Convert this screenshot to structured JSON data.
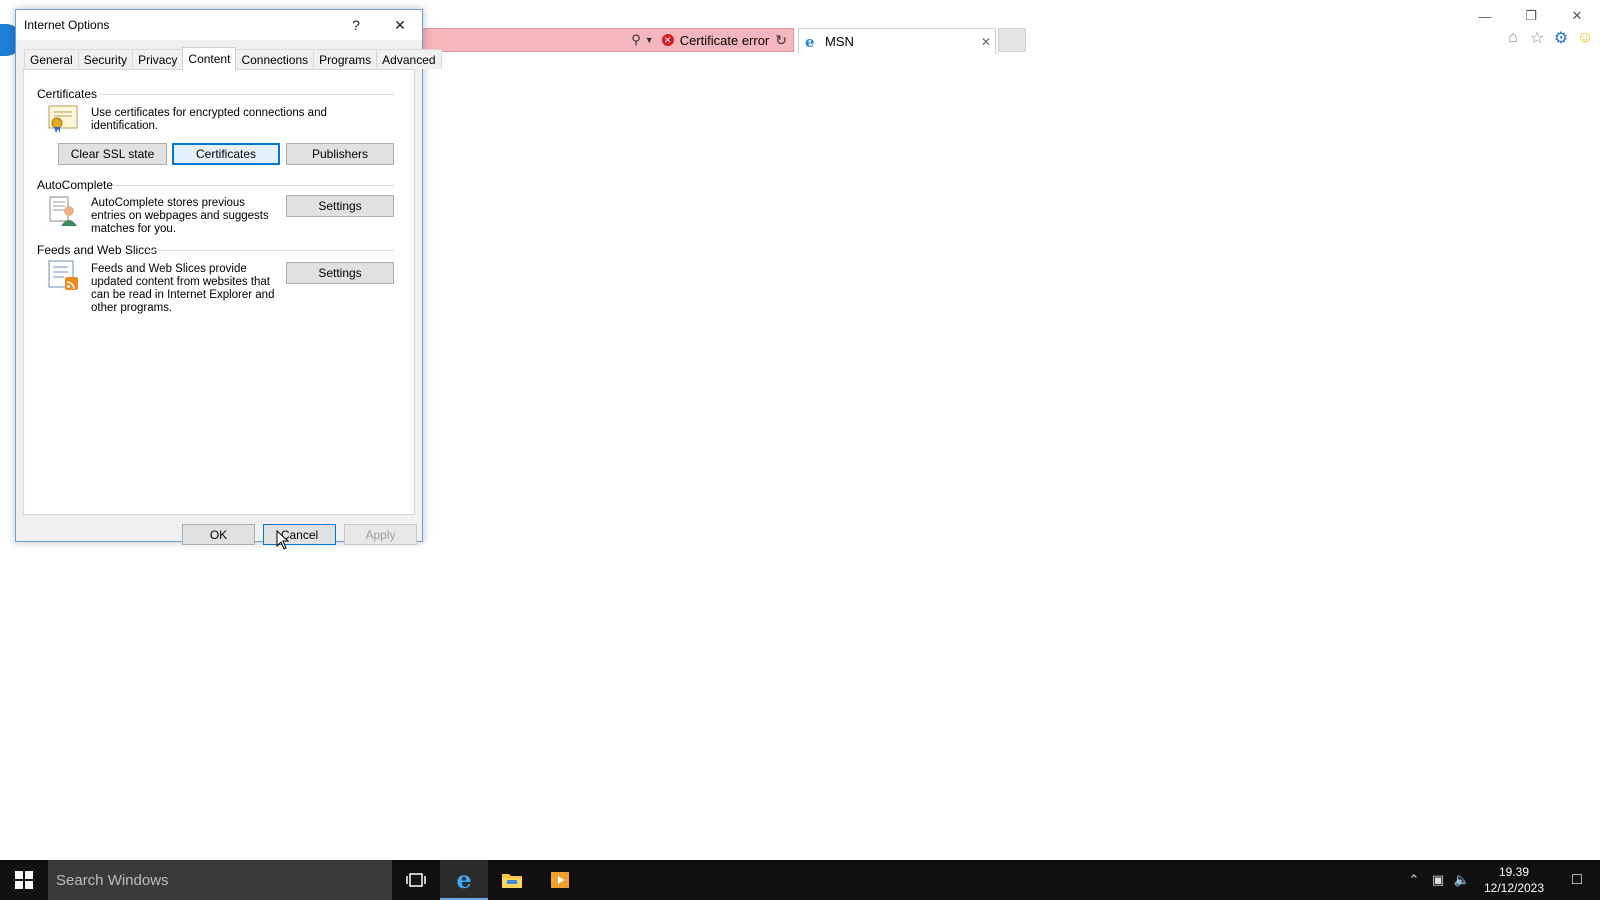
{
  "browser": {
    "address_status": "Certificate error",
    "tab_title": "MSN"
  },
  "dialog": {
    "title": "Internet Options",
    "help_label": "?",
    "tabs": [
      "General",
      "Security",
      "Privacy",
      "Content",
      "Connections",
      "Programs",
      "Advanced"
    ],
    "active_tab": "Content",
    "certificates": {
      "heading": "Certificates",
      "description": "Use certificates for encrypted connections and identification.",
      "clear_ssl_label": "Clear SSL state",
      "certificates_label": "Certificates",
      "publishers_label": "Publishers"
    },
    "autocomplete": {
      "heading": "AutoComplete",
      "description": "AutoComplete stores previous entries on webpages and suggests matches for you.",
      "settings_label": "Settings"
    },
    "feeds": {
      "heading": "Feeds and Web Slices",
      "description": "Feeds and Web Slices provide updated content from websites that can be read in Internet Explorer and other programs.",
      "settings_label": "Settings"
    },
    "ok_label": "OK",
    "cancel_label": "Cancel",
    "apply_label": "Apply"
  },
  "taskbar": {
    "search_placeholder": "Search Windows",
    "time": "19.39",
    "date": "12/12/2023"
  },
  "colors": {
    "address_error_bg": "#f6b6bd",
    "accent": "#0078d7",
    "taskbar_bg": "#101010"
  }
}
